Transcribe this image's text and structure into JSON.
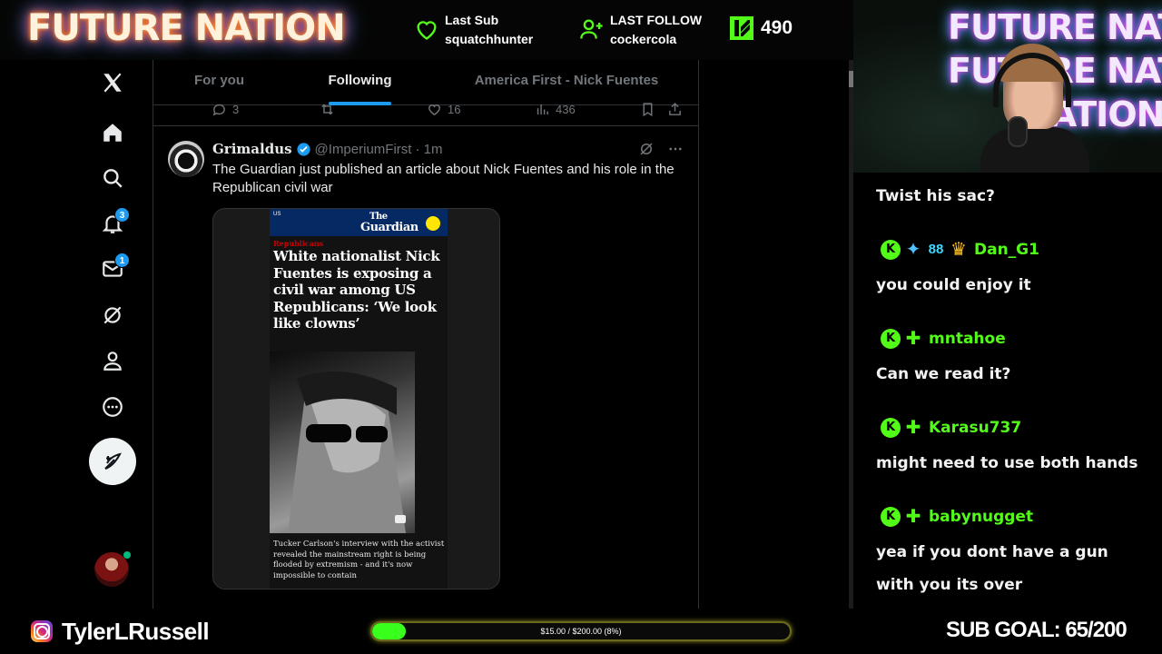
{
  "overlay": {
    "brand": "FUTURE NATION",
    "last_sub_label": "Last Sub",
    "last_sub_name": "squatchhunter",
    "last_follow_label": "LAST FOLLOW",
    "last_follow_name": "cockercola",
    "kick_viewers": "490",
    "accent": "#53fc18"
  },
  "x_nav": {
    "items": [
      "x-logo",
      "home",
      "explore",
      "notifications",
      "messages",
      "grok",
      "profile",
      "more"
    ],
    "notifications_badge": "3",
    "messages_badge": "1"
  },
  "tabs": {
    "for_you": "For you",
    "following": "Following",
    "list": "America First - Nick Fuentes",
    "active": "Following"
  },
  "prev_tweet_actions": {
    "replies": "3",
    "likes": "16",
    "views": "436"
  },
  "tweet": {
    "name": "Grimaldus",
    "handle": "@ImperiumFirst",
    "time": "· 1m",
    "text": "The Guardian just published an article about Nick Fuentes and his role in the Republican civil war",
    "card": {
      "region": "US",
      "logo_line1": "The",
      "logo_line2": "Guardian",
      "kicker": "Republicans",
      "headline": "White nationalist Nick Fuentes is exposing a civil war among US Republicans: ‘We look like clowns’",
      "caption": "Tucker Carlson's interview with the activist revealed the mainstream right is being flooded by extremism - and it's now impossible to contain"
    }
  },
  "cam": {
    "neon_lines": [
      "FUTURE NATION",
      "FUTURE NATION",
      "NATION"
    ]
  },
  "chat": [
    {
      "user": null,
      "text": "Twist his sac?"
    },
    {
      "user": "Dan_G1",
      "badges": [
        "kick",
        "sword",
        "sub",
        "crown"
      ],
      "text": "you could enjoy it"
    },
    {
      "user": "mntahoe",
      "badges": [
        "kick",
        "sub"
      ],
      "text": "Can we read it?"
    },
    {
      "user": "Karasu737",
      "badges": [
        "kick",
        "sub"
      ],
      "text": "might need to use both hands"
    },
    {
      "user": "babynugget",
      "badges": [
        "kick",
        "sub"
      ],
      "text": "yea if you dont have a gun with you its over"
    }
  ],
  "bottom": {
    "instagram": "TylerLRussell",
    "goal_text": "$15.00 / $200.00 (8%)",
    "goal_fraction": 0.08,
    "sub_goal": "SUB GOAL: 65/200"
  }
}
